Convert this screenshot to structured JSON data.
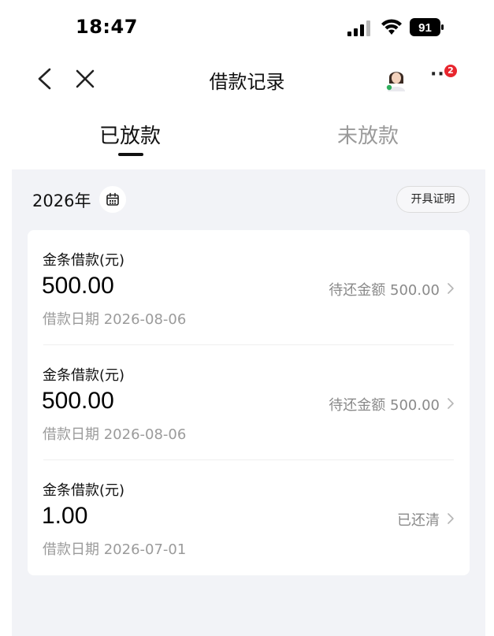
{
  "status_bar": {
    "time": "18:47",
    "battery": "91"
  },
  "nav": {
    "title": "借款记录",
    "notification_count": "2",
    "more_label": "···"
  },
  "tabs": [
    {
      "label": "已放款",
      "active": true
    },
    {
      "label": "未放款",
      "active": false
    }
  ],
  "filter": {
    "year_label": "2026年",
    "certificate_label": "开具证明"
  },
  "loans": [
    {
      "type": "金条借款(元)",
      "amount": "500.00",
      "status": "待还金额 500.00",
      "date": "借款日期 2026-08-06"
    },
    {
      "type": "金条借款(元)",
      "amount": "500.00",
      "status": "待还金额 500.00",
      "date": "借款日期 2026-08-06"
    },
    {
      "type": "金条借款(元)",
      "amount": "1.00",
      "status": "已还清",
      "date": "借款日期 2026-07-01"
    }
  ],
  "colors": {
    "background": "#f2f3f7",
    "badge": "#e8262e",
    "muted_text": "#9b9b9b"
  }
}
